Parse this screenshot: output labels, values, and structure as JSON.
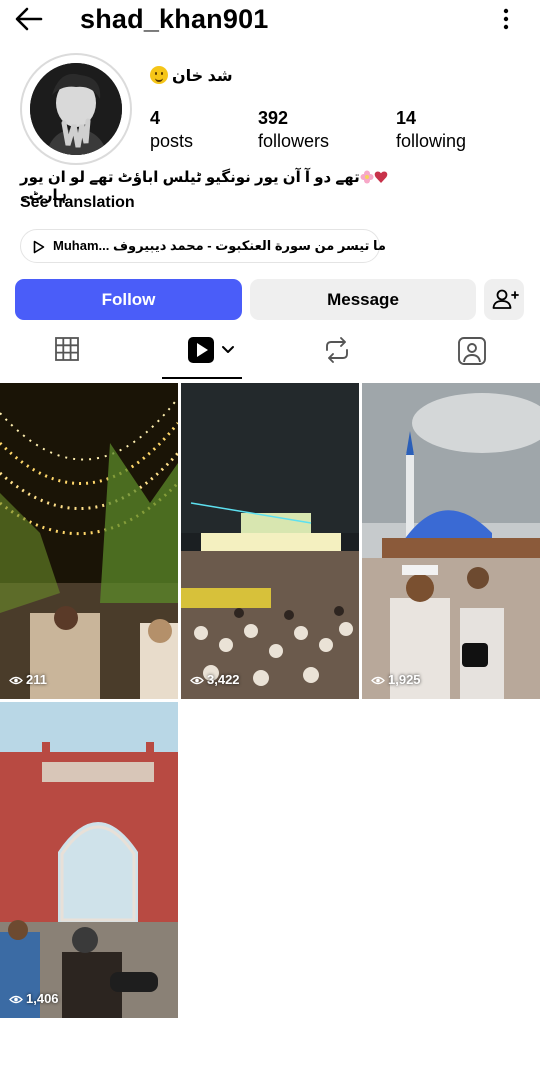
{
  "header": {
    "username": "shad_khan901"
  },
  "profile": {
    "display_name": "شد خان",
    "stats": [
      {
        "value": "4",
        "label": "posts"
      },
      {
        "value": "392",
        "label": "followers"
      },
      {
        "value": "14",
        "label": "following"
      }
    ],
    "bio": "تھے دو آ آن یور نونگیو ٹیلس اباؤٹ تھے لو ان یور ہارٹ۔",
    "see_translation": "See translation",
    "music": "Muham... ما تيسر من سورة العنكبوت - محمد ديبيروف"
  },
  "actions": {
    "follow": "Follow",
    "message": "Message"
  },
  "tabs": [
    {
      "icon": "grid-icon"
    },
    {
      "icon": "reels-icon",
      "active": true
    },
    {
      "icon": "repost-icon"
    },
    {
      "icon": "tagged-icon"
    }
  ],
  "reels": [
    {
      "views": "211"
    },
    {
      "views": "3,422"
    },
    {
      "views": "1,925"
    },
    {
      "views": "1,406"
    }
  ],
  "colors": {
    "follow_button": "#4a5df9",
    "secondary_button": "#efefef"
  }
}
